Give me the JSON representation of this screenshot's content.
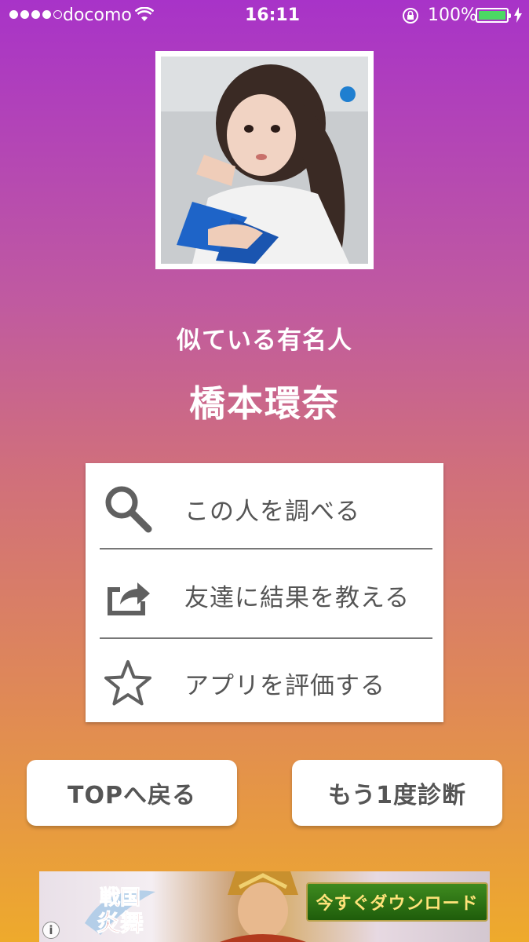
{
  "status_bar": {
    "carrier": "docomo",
    "time": "16:11",
    "battery_percent": "100%",
    "battery_color": "#4cd964"
  },
  "result": {
    "label": "似ている有名人",
    "name": "橋本環奈"
  },
  "menu": {
    "items": [
      {
        "label": "この人を調べる",
        "icon": "search-icon"
      },
      {
        "label": "友達に結果を教える",
        "icon": "share-icon"
      },
      {
        "label": "アプリを評価する",
        "icon": "star-icon"
      }
    ]
  },
  "buttons": {
    "top_label": "TOPへ戻る",
    "retry_label": "もう1度診断"
  },
  "ad": {
    "logo_text": "戦国炎舞",
    "download_label": "今すぐダウンロード",
    "info_label": "i"
  },
  "colors": {
    "gradient_top": "#a833c8",
    "gradient_bottom": "#eeaa2c",
    "menu_text": "#555555"
  }
}
